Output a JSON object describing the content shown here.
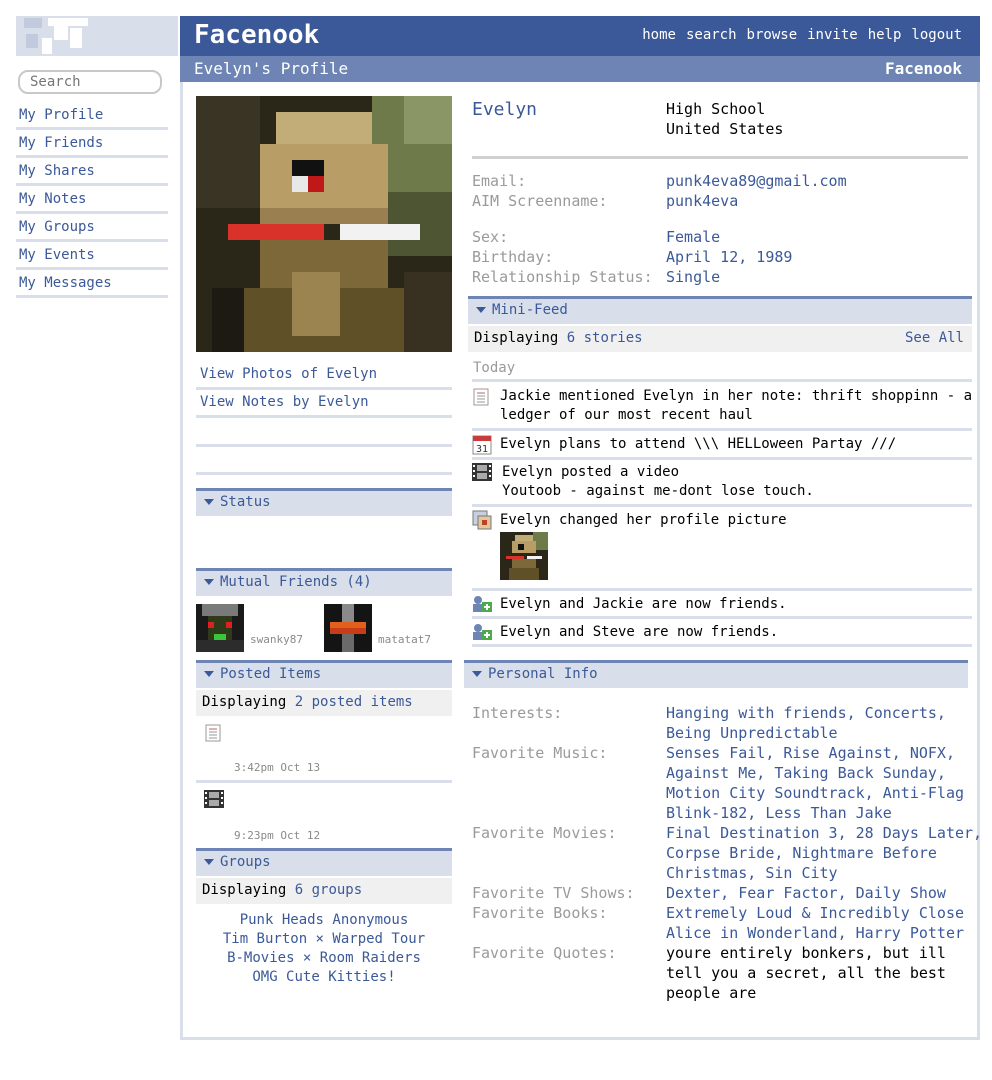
{
  "header": {
    "brand": "Facenook",
    "nav": [
      "home",
      "search",
      "browse",
      "invite",
      "help",
      "logout"
    ],
    "profile_title": "Evelyn's Profile",
    "sub_brand": "Facenook"
  },
  "search": {
    "placeholder": "Search"
  },
  "sidebar": {
    "items": [
      "My Profile",
      "My Friends",
      "My Shares",
      "My Notes",
      "My Groups",
      "My Events",
      "My Messages"
    ]
  },
  "left": {
    "links": [
      "View Photos of Evelyn",
      "View Notes by Evelyn"
    ],
    "status_title": "Status",
    "mutual_title": "Mutual Friends (4)",
    "friends": [
      "swanky87",
      "matatat7"
    ],
    "posted_title": "Posted Items",
    "posted_prefix": "Displaying",
    "posted_count": "2 posted items",
    "posted_times": [
      "3:42pm Oct 13",
      "9:23pm Oct 12"
    ],
    "groups_title": "Groups",
    "groups_prefix": "Displaying",
    "groups_count": "6 groups",
    "groups": [
      "Punk Heads Anonymous",
      "Tim Burton × Warped Tour",
      "B-Movies × Room Raiders",
      "OMG Cute Kitties!"
    ]
  },
  "profile": {
    "name": "Evelyn",
    "network_1": "High School",
    "network_2": "United States",
    "email_label": "Email:",
    "email": "punk4eva89@gmail.com",
    "aim_label": "AIM Screenname:",
    "aim": "punk4eva",
    "sex_label": "Sex:",
    "sex": "Female",
    "birthday_label": "Birthday:",
    "birthday": "April 12, 1989",
    "rel_label": "Relationship Status:",
    "rel": "Single"
  },
  "minifeed": {
    "title": "Mini-Feed",
    "prefix": "Displaying",
    "count": "6 stories",
    "see_all": "See All",
    "day": "Today",
    "stories": [
      "Jackie mentioned Evelyn in her note: thrift shoppinn - a",
      "ledger of our most recent haul",
      "Evelyn plans to attend \\\\\\ HELLoween Partay ///",
      "Evelyn posted a video",
      "Youtoob - against me-dont lose touch.",
      "Evelyn changed her profile picture",
      "Evelyn and Jackie are now friends.",
      "Evelyn and Steve are now friends."
    ],
    "calendar_day": "31"
  },
  "personal": {
    "title": "Personal Info",
    "interests_label": "Interests:",
    "interests": [
      "Hanging with friends, Concerts,",
      "Being Unpredictable"
    ],
    "music_label": "Favorite Music:",
    "music": [
      "Senses Fail, Rise Against, NOFX,",
      "Against Me, Taking Back Sunday,",
      "Motion City Soundtrack, Anti-Flag",
      "Blink-182, Less Than Jake"
    ],
    "movies_label": "Favorite Movies:",
    "movies": [
      "Final Destination 3, 28 Days Later,",
      "Corpse Bride, Nightmare Before",
      "Christmas, Sin City"
    ],
    "tv_label": "Favorite TV Shows:",
    "tv": "Dexter, Fear Factor, Daily Show",
    "books_label": "Favorite Books:",
    "books": [
      "Extremely Loud & Incredibly Close",
      "Alice in Wonderland, Harry Potter"
    ],
    "quotes_label": "Favorite Quotes:",
    "quotes": [
      "youre entirely bonkers, but ill",
      "tell you a secret, all the best",
      "people are"
    ]
  }
}
